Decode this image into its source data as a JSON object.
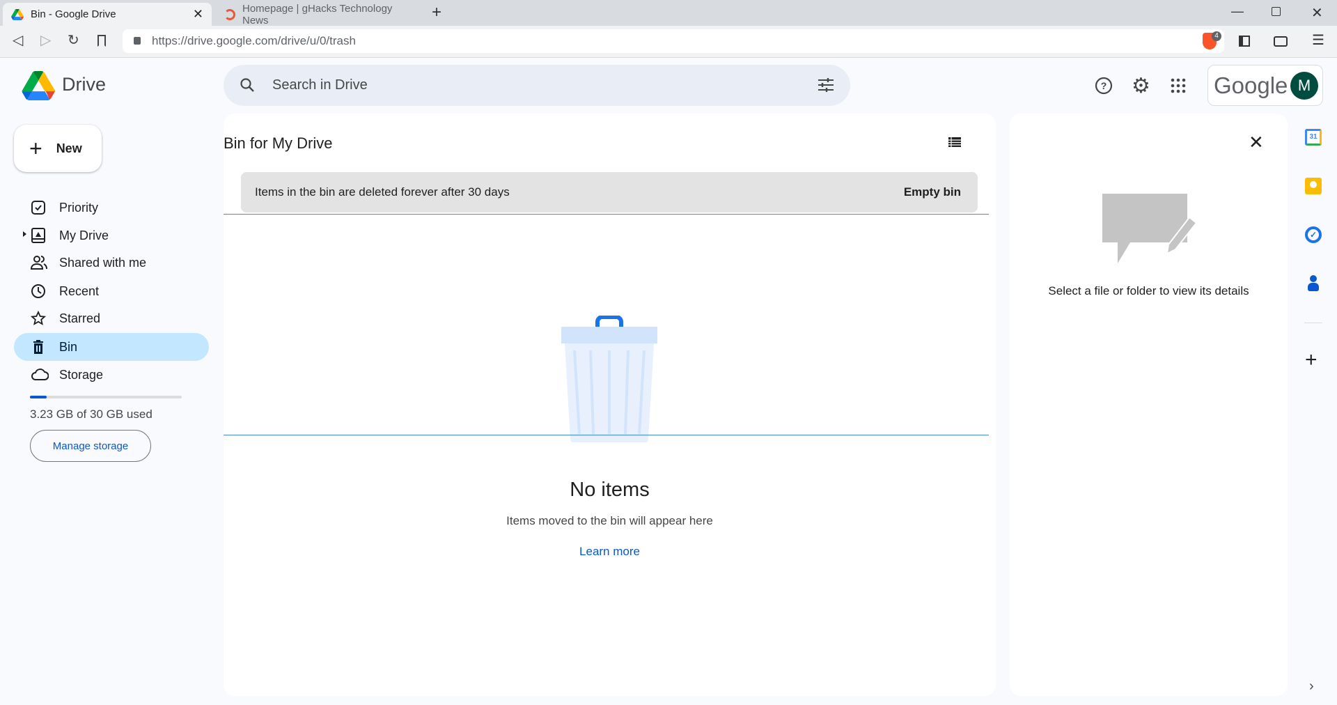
{
  "browser": {
    "tabs": [
      {
        "title": "Bin - Google Drive",
        "active": true
      },
      {
        "title": "Homepage | gHacks Technology News",
        "active": false
      }
    ],
    "url": "https://drive.google.com/drive/u/0/trash",
    "shields_count": "4"
  },
  "app": {
    "name": "Drive",
    "search_placeholder": "Search in Drive",
    "account_brand": "Google",
    "avatar_initial": "M",
    "avatar_color": "#004d40"
  },
  "sidebar": {
    "new_label": "New",
    "items": [
      {
        "label": "Priority",
        "icon": "priority-icon"
      },
      {
        "label": "My Drive",
        "icon": "my-drive-icon"
      },
      {
        "label": "Shared with me",
        "icon": "shared-icon"
      },
      {
        "label": "Recent",
        "icon": "clock-icon"
      },
      {
        "label": "Starred",
        "icon": "star-icon"
      },
      {
        "label": "Bin",
        "icon": "trash-icon",
        "active": true
      },
      {
        "label": "Storage",
        "icon": "cloud-icon"
      }
    ],
    "storage": {
      "used_text": "3.23 GB of 30 GB used",
      "used_fraction": 0.108,
      "manage_label": "Manage storage"
    }
  },
  "main": {
    "title": "Bin for My Drive",
    "banner_text": "Items in the bin are deleted forever after 30 days",
    "empty_bin_label": "Empty bin",
    "empty_title": "No items",
    "empty_subtitle": "Items moved to the bin will appear here",
    "learn_more": "Learn more"
  },
  "details": {
    "message": "Select a file or folder to view its details"
  },
  "colors": {
    "accent": "#0b57d0",
    "active_nav": "#c2e7ff"
  }
}
